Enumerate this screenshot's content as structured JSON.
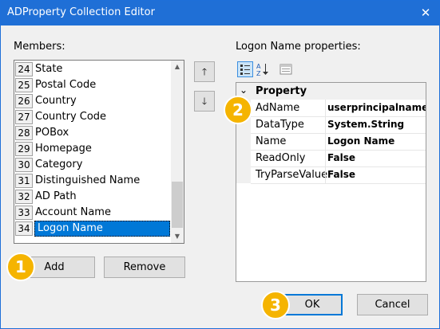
{
  "window": {
    "title": "ADProperty Collection Editor",
    "close_glyph": "✕"
  },
  "members": {
    "label": "Members:",
    "items": [
      {
        "index": "24",
        "name": "State"
      },
      {
        "index": "25",
        "name": "Postal Code"
      },
      {
        "index": "26",
        "name": "Country"
      },
      {
        "index": "27",
        "name": "Country Code"
      },
      {
        "index": "28",
        "name": "POBox"
      },
      {
        "index": "29",
        "name": "Homepage"
      },
      {
        "index": "30",
        "name": "Category"
      },
      {
        "index": "31",
        "name": "Distinguished Name"
      },
      {
        "index": "32",
        "name": "AD Path"
      },
      {
        "index": "33",
        "name": "Account Name"
      },
      {
        "index": "34",
        "name": "Logon Name"
      }
    ],
    "selected_index": "34",
    "move_up_glyph": "🡑",
    "move_down_glyph": "🡓",
    "add_label": "Add",
    "remove_label": "Remove"
  },
  "properties": {
    "label": "Logon Name properties:",
    "category": "Property",
    "collapse_glyph": "⌄",
    "rows": [
      {
        "name": "AdName",
        "value": "userprincipalname"
      },
      {
        "name": "DataType",
        "value": "System.String"
      },
      {
        "name": "Name",
        "value": "Logon Name"
      },
      {
        "name": "ReadOnly",
        "value": "False"
      },
      {
        "name": "TryParseValue",
        "value": "False"
      }
    ],
    "toolbar": {
      "categorized_icon": "categorized-icon",
      "alphabetical_icon": "alphabetical-icon",
      "pages_icon": "property-pages-icon"
    }
  },
  "buttons": {
    "ok_label": "OK",
    "cancel_label": "Cancel"
  },
  "annotations": {
    "badge1": "1",
    "badge2": "2",
    "badge3": "3",
    "color": "#f5b400"
  },
  "colors": {
    "titlebar": "#1f6fd6",
    "selection": "#0078d7"
  }
}
